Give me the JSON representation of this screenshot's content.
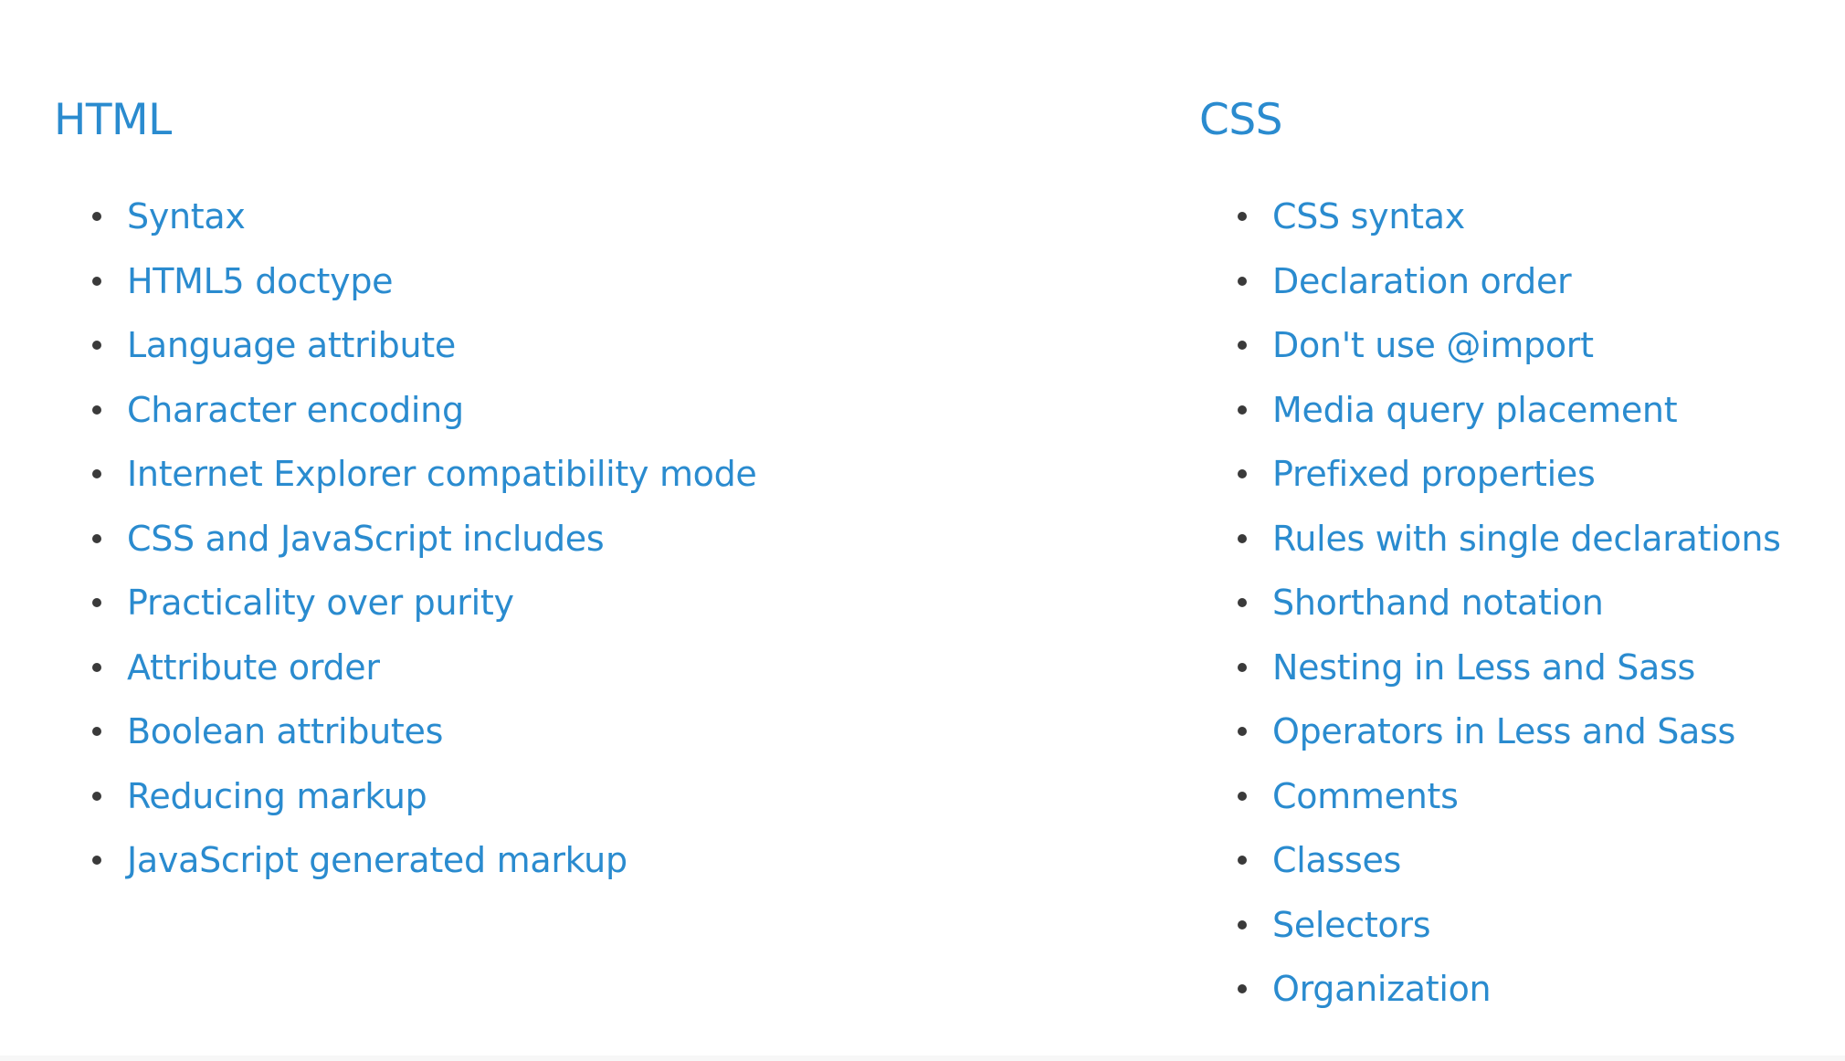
{
  "sections": [
    {
      "title": "HTML",
      "items": [
        "Syntax",
        "HTML5 doctype",
        "Language attribute",
        "Character encoding",
        "Internet Explorer compatibility mode",
        "CSS and JavaScript includes",
        "Practicality over purity",
        "Attribute order",
        "Boolean attributes",
        "Reducing markup",
        "JavaScript generated markup"
      ]
    },
    {
      "title": "CSS",
      "items": [
        "CSS syntax",
        "Declaration order",
        "Don't use @import",
        "Media query placement",
        "Prefixed properties",
        "Rules with single declarations",
        "Shorthand notation",
        "Nesting in Less and Sass",
        "Operators in Less and Sass",
        "Comments",
        "Classes",
        "Selectors",
        "Organization"
      ]
    }
  ],
  "colors": {
    "link": "#2a8bcf",
    "bullet": "#3a3a3a",
    "background": "#ffffff"
  }
}
